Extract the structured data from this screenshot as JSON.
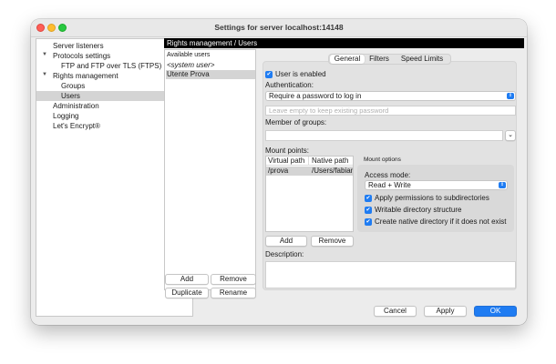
{
  "window": {
    "title": "Settings for server localhost:14148"
  },
  "tree": {
    "items": [
      {
        "label": "Server listeners"
      },
      {
        "label": "Protocols settings"
      },
      {
        "label": "FTP and FTP over TLS (FTPS)"
      },
      {
        "label": "Rights management"
      },
      {
        "label": "Groups"
      },
      {
        "label": "Users"
      },
      {
        "label": "Administration"
      },
      {
        "label": "Logging"
      },
      {
        "label": "Let's Encrypt®"
      }
    ]
  },
  "panel": {
    "header": "Rights management / Users"
  },
  "users": {
    "label": "Available users",
    "items": [
      "<system user>",
      "Utente Prova"
    ],
    "buttons": {
      "add": "Add",
      "remove": "Remove",
      "duplicate": "Duplicate",
      "rename": "Rename"
    }
  },
  "tabs": [
    "General",
    "Filters",
    "Speed Limits"
  ],
  "general": {
    "user_enabled": "User is enabled",
    "auth_label": "Authentication:",
    "auth_value": "Require a password to log in",
    "password_placeholder": "Leave empty to keep existing password",
    "groups_label": "Member of groups:",
    "mount_points_label": "Mount points:",
    "mount_table": {
      "columns": [
        "Virtual path",
        "Native path"
      ],
      "rows": [
        [
          "/prova",
          "/Users/fabian"
        ]
      ]
    },
    "mount_add": "Add",
    "mount_remove": "Remove",
    "mount_options": {
      "title": "Mount options",
      "access_label": "Access mode:",
      "access_value": "Read + Write",
      "apply_perms": "Apply permissions to subdirectories",
      "writable": "Writable directory structure",
      "create_native": "Create native directory if it does not exist"
    },
    "description_label": "Description:"
  },
  "footer": {
    "cancel": "Cancel",
    "apply": "Apply",
    "ok": "OK"
  },
  "colors": {
    "accent": "#1f7cf2",
    "header_bg": "#000000",
    "selection": "#d4d4d4"
  },
  "icons": [
    "checkmark-icon",
    "chevron-updown-icon",
    "chevron-down-icon",
    "disclosure-arrow-icon"
  ]
}
